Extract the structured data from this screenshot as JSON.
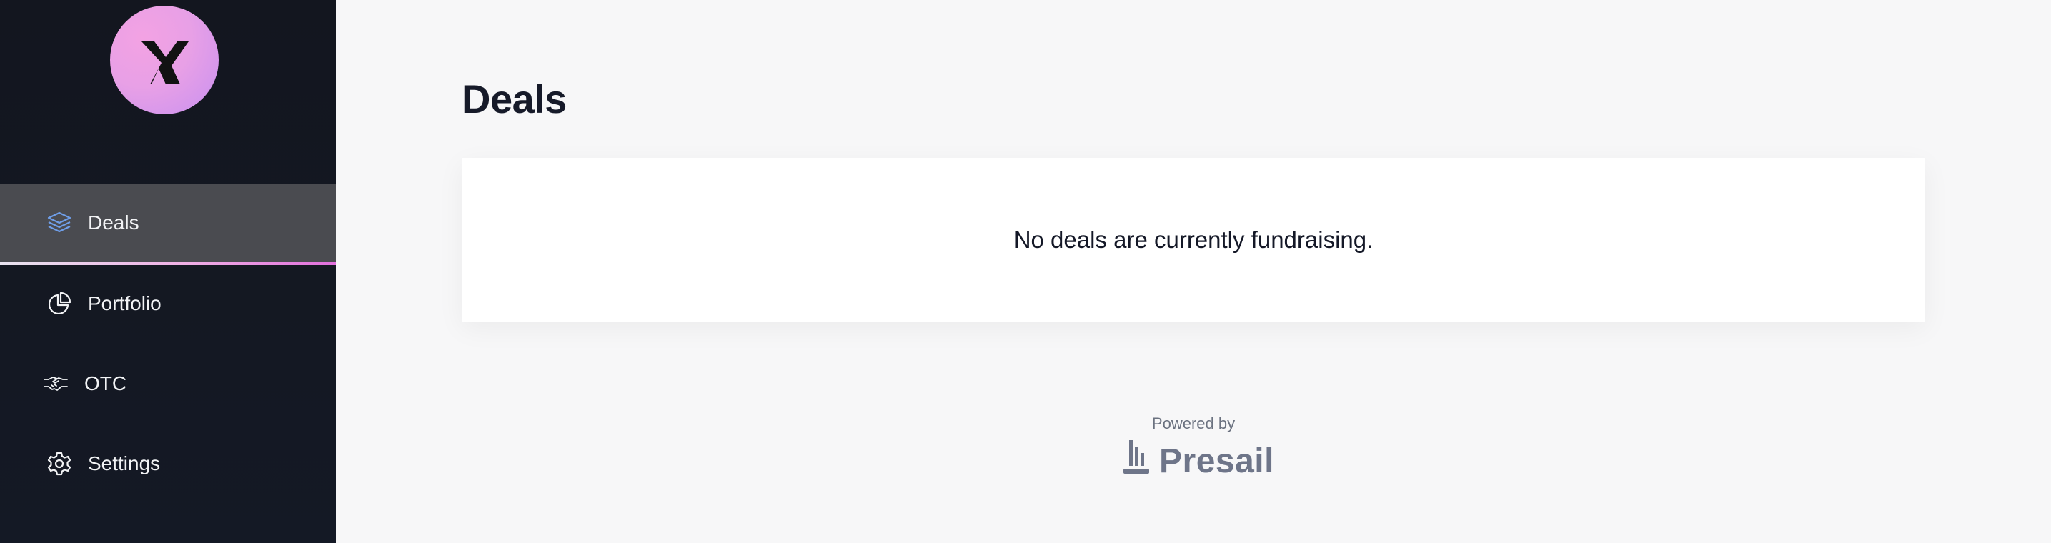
{
  "sidebar": {
    "logo_letter": "Y",
    "items": [
      {
        "label": "Deals",
        "icon": "layers-icon",
        "active": true
      },
      {
        "label": "Portfolio",
        "icon": "pie-chart-icon",
        "active": false
      },
      {
        "label": "OTC",
        "icon": "handshake-icon",
        "active": false
      },
      {
        "label": "Settings",
        "icon": "gear-icon",
        "active": false
      }
    ]
  },
  "main": {
    "title": "Deals",
    "empty_message": "No deals are currently fundraising."
  },
  "footer": {
    "powered_by": "Powered by",
    "brand": "Presail"
  },
  "colors": {
    "sidebar_bg": "#13161f",
    "active_item_bg": "#4a4b50",
    "accent": "#e26fdd",
    "icon_active": "#6f9ee8",
    "text_dark": "#161a29",
    "brand_gray": "#6e7589"
  }
}
